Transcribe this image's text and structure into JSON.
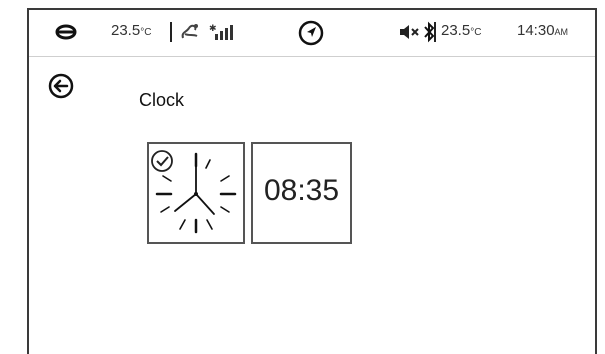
{
  "status_bar": {
    "left_temperature": {
      "value": "23.5",
      "unit": "°C"
    },
    "right_temperature": {
      "value": "23.5",
      "unit": "°C"
    },
    "time": {
      "value": "14:30",
      "suffix": "AM"
    },
    "icons": [
      "steering-wheel-icon",
      "fan-icon",
      "signal-strength-icon",
      "navigation-icon",
      "mute-icon",
      "bluetooth-icon"
    ]
  },
  "page": {
    "title": "Clock"
  },
  "clock_options": {
    "analog_selected": true,
    "digital_time": "08:35"
  }
}
